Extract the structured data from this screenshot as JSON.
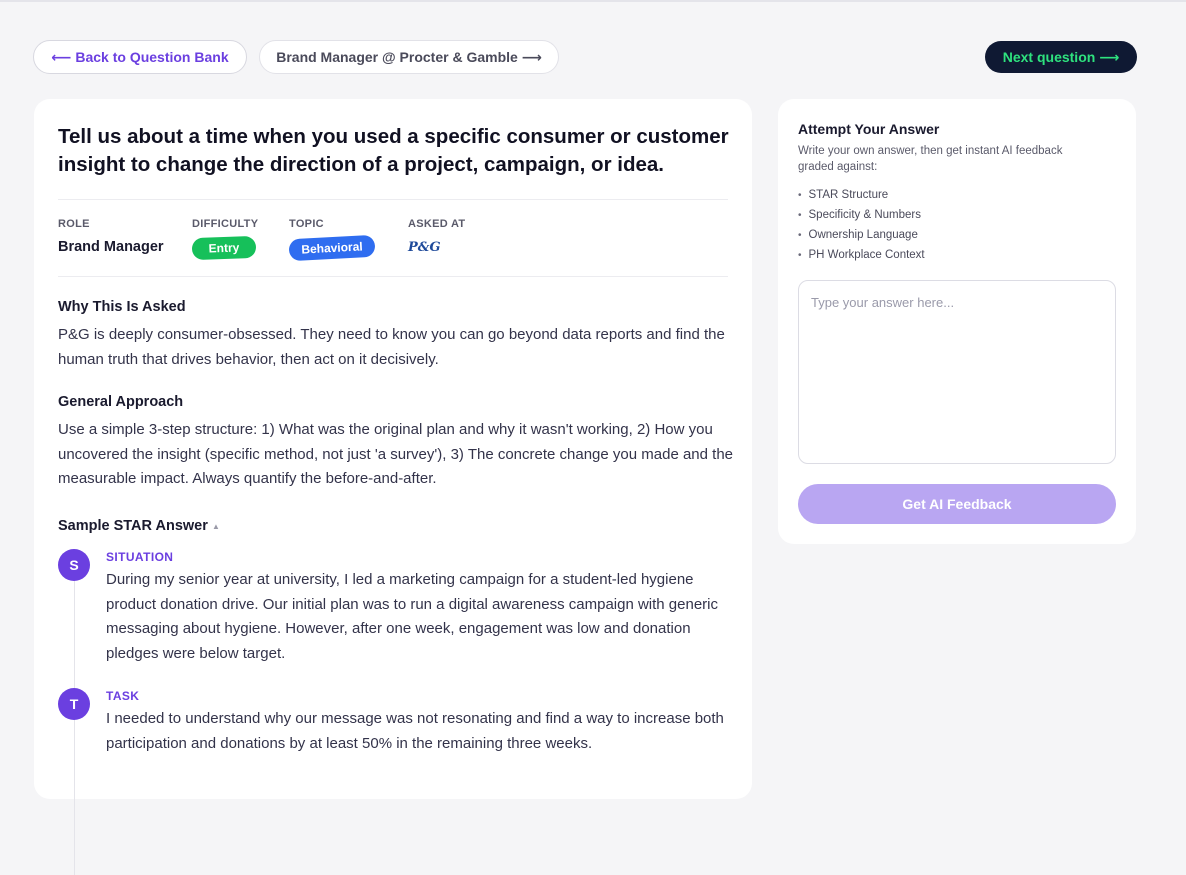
{
  "nav": {
    "back_label": "⟵ Back to Question Bank",
    "company_label": "Brand Manager @ Procter & Gamble ⟶",
    "next_label": "Next question ⟶"
  },
  "question": {
    "title": "Tell us about a time when you used a specific consumer or customer insight to change the direction of a project, campaign, or idea."
  },
  "meta": {
    "role_label": "ROLE",
    "role_value": "Brand Manager",
    "difficulty_label": "DIFFICULTY",
    "difficulty_value": "Entry",
    "topic_label": "TOPIC",
    "topic_value": "Behavioral",
    "asked_label": "ASKED AT",
    "asked_logo": "P&G"
  },
  "why": {
    "title": "Why This Is Asked",
    "body": "P&G is deeply consumer-obsessed. They need to know you can go beyond data reports and find the human truth that drives behavior, then act on it decisively."
  },
  "approach": {
    "title": "General Approach",
    "body": "Use a simple 3-step structure: 1) What was the original plan and why it wasn't working, 2) How you uncovered the insight (specific method, not just 'a survey'), 3) The concrete change you made and the measurable impact. Always quantify the before-and-after."
  },
  "sample": {
    "title": "Sample STAR Answer",
    "caret": "▲",
    "steps": [
      {
        "letter": "S",
        "label": "SITUATION",
        "body": "During my senior year at university, I led a marketing campaign for a student-led hygiene product donation drive. Our initial plan was to run a digital awareness campaign with generic messaging about hygiene. However, after one week, engagement was low and donation pledges were below target."
      },
      {
        "letter": "T",
        "label": "TASK",
        "body": "I needed to understand why our message was not resonating and find a way to increase both participation and donations by at least 50% in the remaining three weeks."
      }
    ]
  },
  "attempt": {
    "title": "Attempt Your Answer",
    "description": "Write your own answer, then get instant AI feedback graded against:",
    "criteria": [
      "STAR Structure",
      "Specificity & Numbers",
      "Ownership Language",
      "PH Workplace Context"
    ],
    "placeholder": "Type your answer here...",
    "button_label": "Get AI Feedback"
  },
  "colors": {
    "accent": "#6b3fe0",
    "entry_green": "#16c05a",
    "behavioral_blue": "#2f6df0",
    "next_bg": "#0f1933",
    "next_text": "#2ee27e",
    "feedback_disabled": "#b9a6f2"
  }
}
